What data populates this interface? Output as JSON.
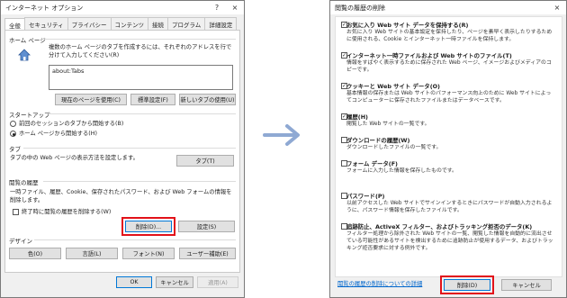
{
  "left": {
    "title": "インターネット オプション",
    "help": "?",
    "close": "×",
    "tabs": [
      "全般",
      "セキュリティ",
      "プライバシー",
      "コンテンツ",
      "接続",
      "プログラム",
      "詳細設定"
    ],
    "home": {
      "group": "ホーム ページ",
      "desc": "複数のホーム ページのタブを作成するには、それぞれのアドレスを行で分けて入力してください(R)",
      "value": "about:Tabs",
      "btn_current": "現在のページを使用(C)",
      "btn_default": "標準設定(F)",
      "btn_newtab": "新しいタブの使用(U)"
    },
    "startup": {
      "group": "スタートアップ",
      "opt1": "前回のセッションのタブから開始する(B)",
      "opt2": "ホーム ページから開始する(H)"
    },
    "tabs_group": {
      "group": "タブ",
      "desc": "タブの中の Web ページの表示方法を設定します。",
      "btn": "タブ(T)"
    },
    "history": {
      "group": "閲覧の履歴",
      "desc": "一時ファイル、履歴、Cookie、保存されたパスワード、および Web フォームの情報を削除します。",
      "check": "終了時に閲覧の履歴を削除する(W)",
      "btn_delete": "削除(D)...",
      "btn_settings": "設定(S)"
    },
    "design": {
      "group": "デザイン",
      "btn_color": "色(O)",
      "btn_lang": "言語(L)",
      "btn_font": "フォント(N)",
      "btn_access": "ユーザー補助(E)"
    },
    "footer": {
      "ok": "OK",
      "cancel": "キャンセル",
      "apply": "適用(A)"
    }
  },
  "right": {
    "title": "閲覧の履歴の削除",
    "close": "×",
    "items": [
      {
        "title": "お気に入り Web サイト データを保持する(R)",
        "desc": "お気に入り Web サイトの基本設定を保持したり、ページを素早く表示したりするために使用される、Cookie とインターネット一時ファイルを保持します。",
        "checked": true
      },
      {
        "title": "インターネット一時ファイルおよび Web サイトのファイル(T)",
        "desc": "情報をすばやく表示するために保存された Web ページ、イメージおよびメディアのコピーです。",
        "checked": true
      },
      {
        "title": "クッキーと Web サイト データ(O)",
        "desc": "基本情報の保存または Web サイトのパフォーマンス向上のために Web サイトによってコンピューターに保存されたファイルまたはデータベースです。",
        "checked": true
      },
      {
        "title": "履歴(H)",
        "desc": "閲覧した Web サイトの一覧です。",
        "checked": true
      },
      {
        "title": "ダウンロードの履歴(W)",
        "desc": "ダウンロードしたファイルの一覧です。",
        "checked": false
      },
      {
        "title": "フォーム データ(F)",
        "desc": "フォームに入力した情報を保存したものです。",
        "checked": false
      },
      {
        "title": "パスワード(P)",
        "desc": "以前アクセスした Web サイトでサインインするときにパスワードが自動入力されるように、パスワード情報を保存したファイルです。",
        "checked": false
      },
      {
        "title": "追跡防止、ActiveX フィルター、およびトラッキング拒否のデータ(K)",
        "desc": "フィルター処理から除外された Web サイトの一覧、閲覧した情報を自動的に流出させている可能性があるサイトを検出するために追跡防止が使用するデータ、およびトラッキング拒否要求に対する例外です。",
        "checked": false
      }
    ],
    "link": "閲覧の履歴の削除についての詳細",
    "btn_delete": "削除(D)",
    "btn_cancel": "キャンセル"
  },
  "colors": {
    "highlight": "#e2121a",
    "arrow": "#8fa9d3"
  }
}
